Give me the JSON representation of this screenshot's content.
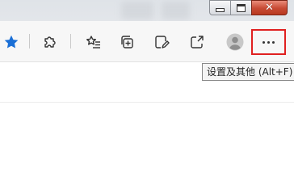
{
  "window_controls": {
    "minimize_icon": "minimize-icon",
    "maximize_icon": "restore-icon",
    "close_label": "✕"
  },
  "toolbar": {
    "icons": [
      "favorite-star-icon",
      "extensions-icon",
      "favorites-list-icon",
      "collections-icon",
      "web-capture-icon",
      "share-icon",
      "profile-avatar-icon",
      "more-icon"
    ],
    "accent_color": "#1a6fd6",
    "highlight_color": "#e02020"
  },
  "tooltip": {
    "text": "设置及其他 (Alt+F)"
  }
}
